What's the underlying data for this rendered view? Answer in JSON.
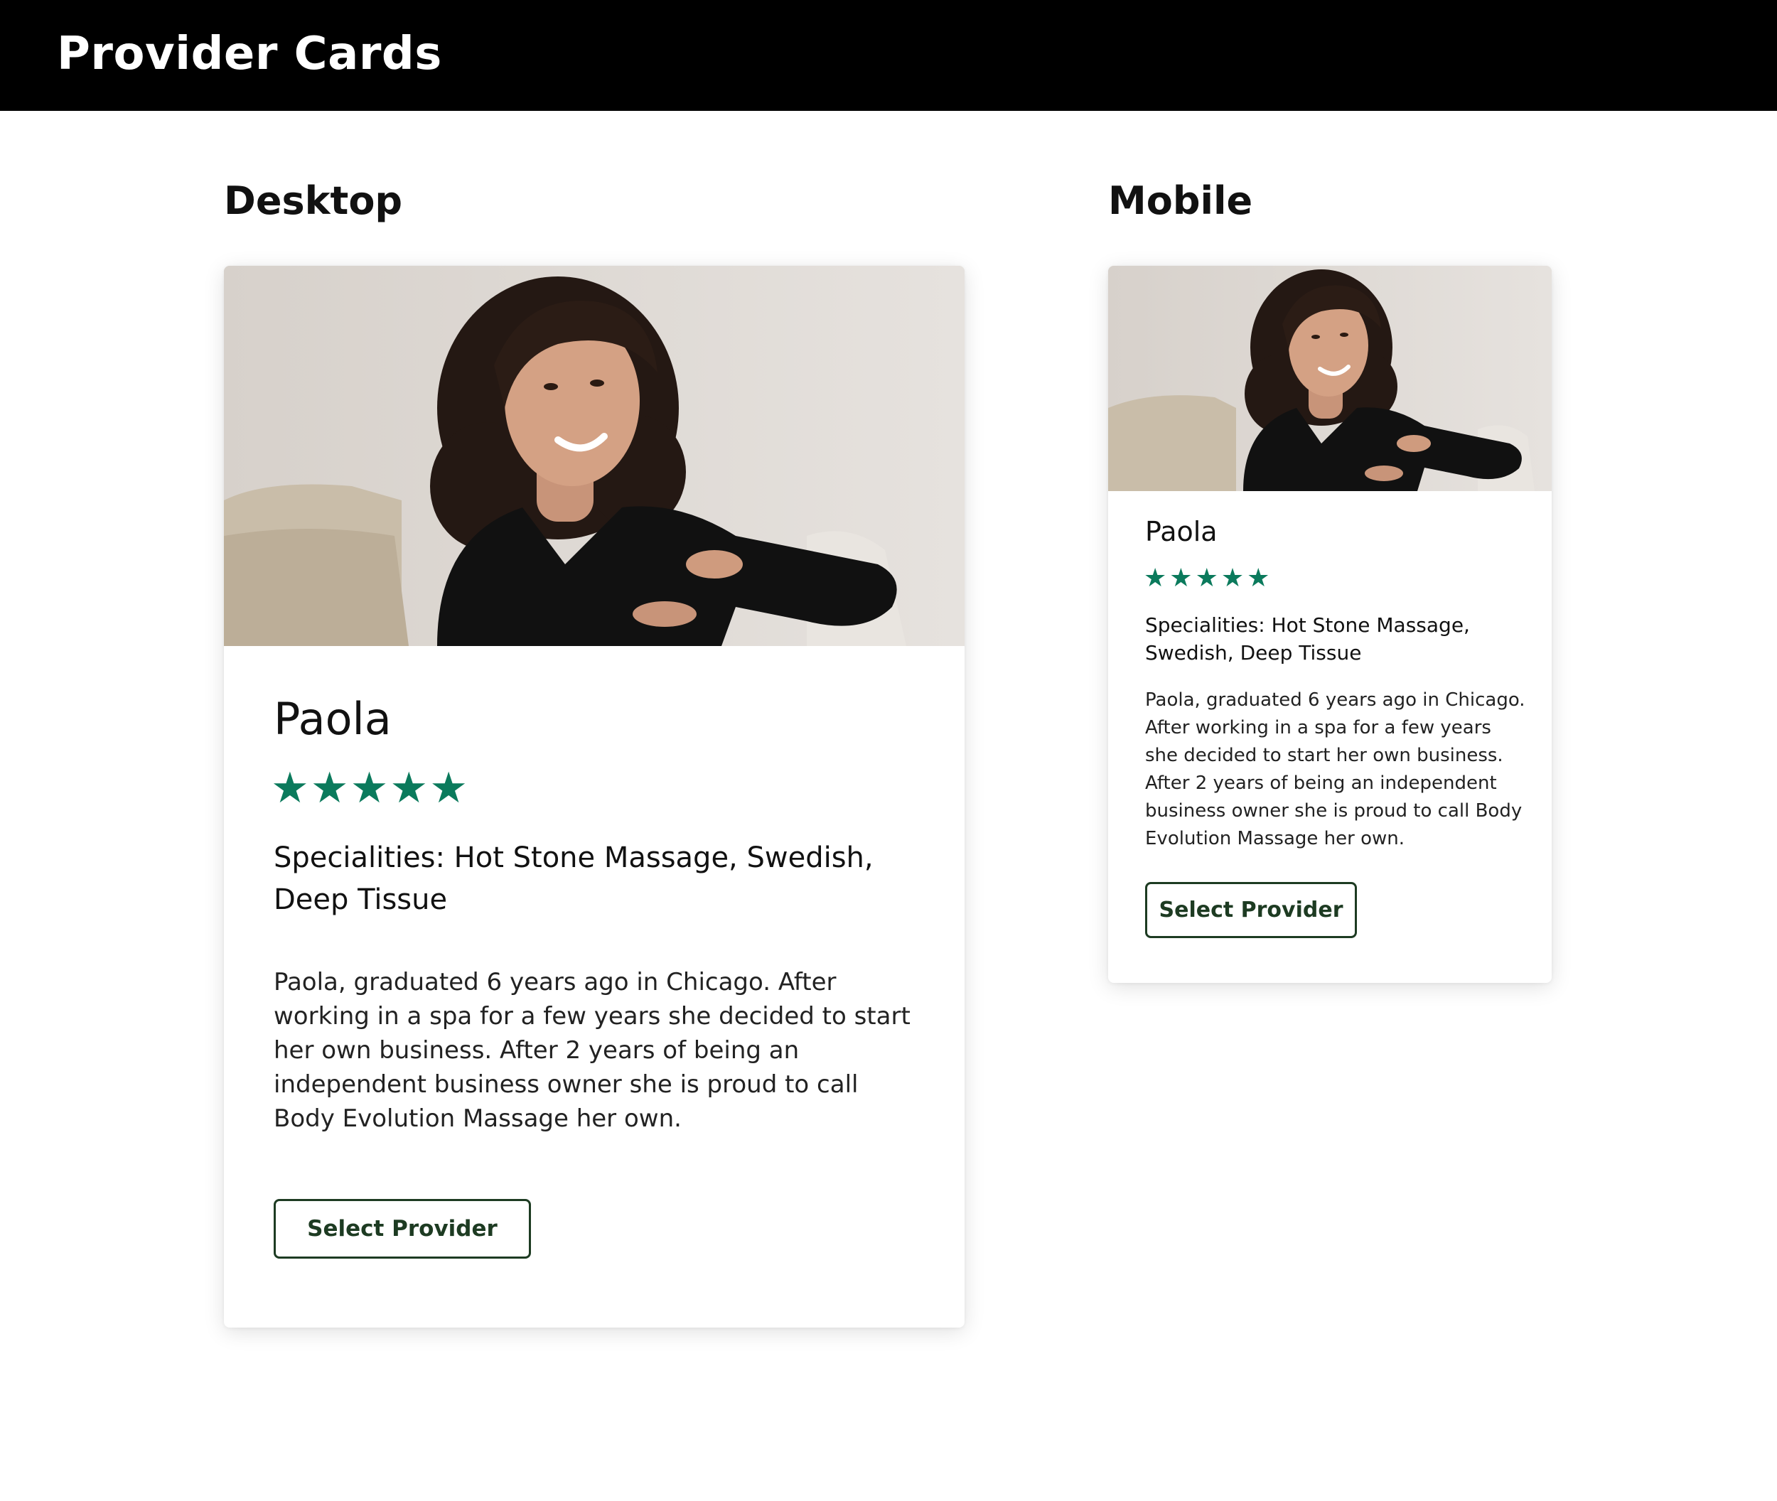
{
  "header": {
    "title": "Provider Cards"
  },
  "sections": {
    "desktop": "Desktop",
    "mobile": "Mobile"
  },
  "provider": {
    "name": "Paola",
    "rating": 5,
    "rating_max": 5,
    "stars": [
      "★",
      "★",
      "★",
      "★",
      "★"
    ],
    "specialities": "Specialities: Hot Stone Massage, Swedish, Deep Tissue",
    "bio": "Paola, graduated 6 years ago in Chicago. After working in a spa for a few years she decided to start her own business. After 2 years of being an independent business owner she is proud to call Body Evolution Massage her own.",
    "button_label": "Select Provider"
  },
  "colors": {
    "header_bg": "#000000",
    "star": "#0b7a5c",
    "button_border": "#1d3b22"
  }
}
